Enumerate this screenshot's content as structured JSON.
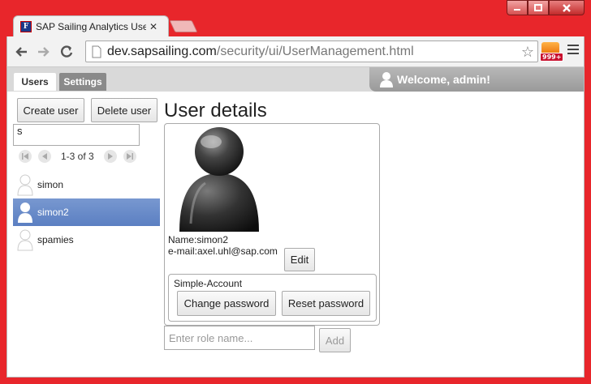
{
  "browser": {
    "tab_title": "SAP Sailing Analytics User",
    "tab_favicon_letter": "F",
    "url_host": "dev.sapsailing.com",
    "url_path": "/security/ui/UserManagement.html",
    "rss_badge": "999+"
  },
  "app": {
    "tabs": [
      {
        "label": "Users",
        "active": true
      },
      {
        "label": "Settings",
        "active": false
      }
    ],
    "welcome": "Welcome, admin!"
  },
  "left": {
    "create_user": "Create user",
    "delete_user": "Delete user",
    "filter_value": "s",
    "pager_text": "1-3 of 3",
    "users": [
      {
        "name": "simon",
        "selected": false
      },
      {
        "name": "simon2",
        "selected": true
      },
      {
        "name": "spamies",
        "selected": false
      }
    ]
  },
  "details": {
    "title": "User details",
    "name_line": "Name:simon2",
    "email_line": "e-mail:axel.uhl@sap.com",
    "edit": "Edit",
    "account_label": "Simple-Account",
    "change_password": "Change password",
    "reset_password": "Reset password",
    "role_placeholder": "Enter role name...",
    "add": "Add"
  },
  "colors": {
    "frame": "#e8262b",
    "selected_row": "#5b7fc2",
    "header_gray": "#d9d9d9"
  }
}
